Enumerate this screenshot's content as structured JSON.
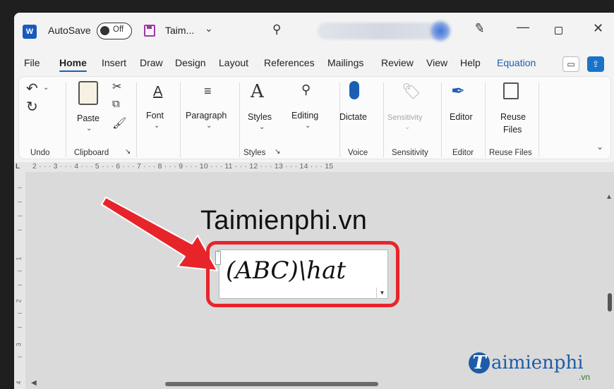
{
  "titlebar": {
    "app_logo": "W",
    "autosave_label": "AutoSave",
    "autosave_state": "Off",
    "doc_name": "Taim...",
    "chevron": "⌄",
    "search_icon": "search-icon",
    "pen_icon": "pen-icon",
    "minimize": "—",
    "close": "✕"
  },
  "tabs": [
    "File",
    "Home",
    "Insert",
    "Draw",
    "Design",
    "Layout",
    "References",
    "Mailings",
    "Review",
    "View",
    "Help",
    "Equation"
  ],
  "active_tab": "Home",
  "ribbon": {
    "undo_group": "Undo",
    "clipboard": {
      "paste": "Paste",
      "group": "Clipboard"
    },
    "font": {
      "label": "Font"
    },
    "paragraph": {
      "label": "Paragraph"
    },
    "styles": {
      "label": "Styles",
      "group": "Styles"
    },
    "editing": {
      "label": "Editing"
    },
    "voice": {
      "label": "Dictate",
      "group": "Voice"
    },
    "sensitivity": {
      "label": "Sensitivity",
      "group": "Sensitivity"
    },
    "editor": {
      "label": "Editor",
      "group": "Editor"
    },
    "reuse": {
      "label1": "Reuse",
      "label2": "Files",
      "group": "Reuse Files"
    }
  },
  "ruler_text": "2 · · · 3 · · · 4 · · · 5 · · · 6 · · · 7 · · · 8 · · · 9 · · · 10 · · · 11 · · · 12 · · · 13 · · · 14 · · · 15",
  "vertical_ruler": [
    "1",
    "2",
    "3",
    "4"
  ],
  "document": {
    "heading": "Taimienphi.vn",
    "equation": "(ABC)\\hat"
  },
  "watermark": {
    "initial": "T",
    "text": "aimienphi",
    "suffix": ".vn"
  },
  "colors": {
    "highlight": "#e8242b",
    "arrow": "#e8242b",
    "accent": "#1a5fb4"
  }
}
